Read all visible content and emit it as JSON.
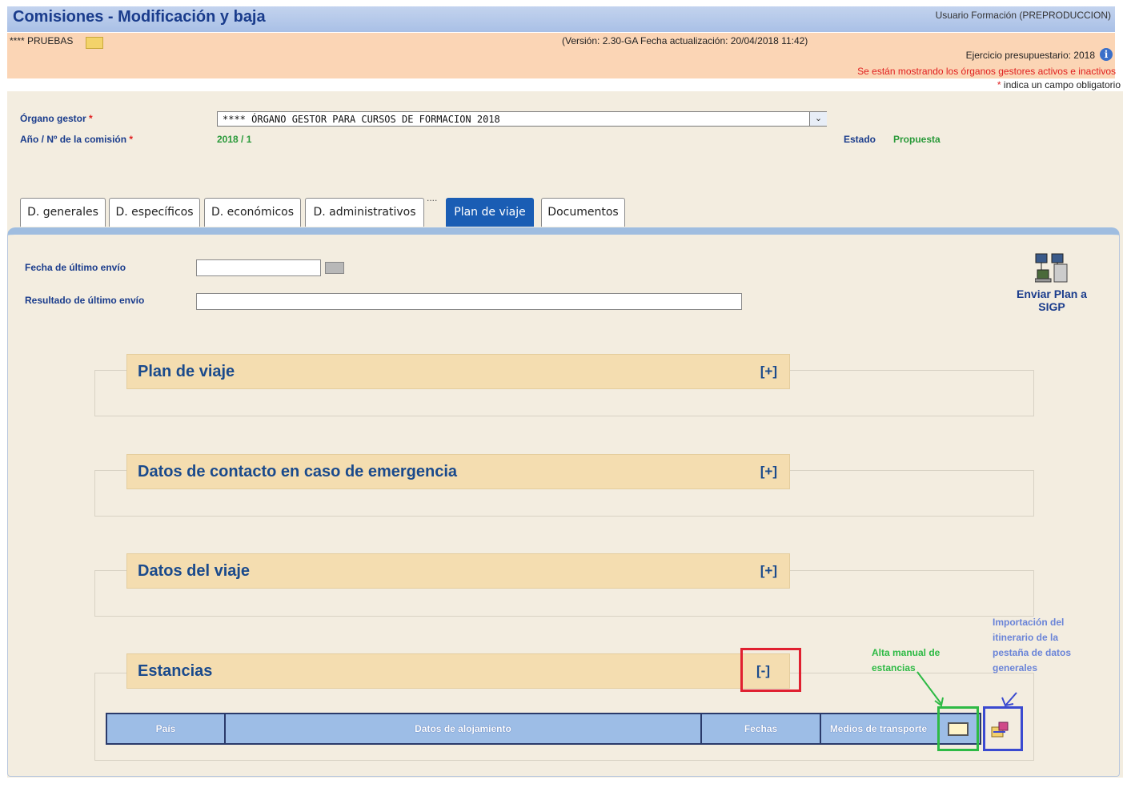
{
  "header": {
    "title": "Comisiones - Modificación y baja",
    "user": "Usuario Formación (PREPRODUCCION)"
  },
  "infobar": {
    "env": "**** PRUEBAS",
    "version": "(Versión: 2.30-GA Fecha actualización: 20/04/2018 11:42)",
    "ejercicio": "Ejercicio presupuestario: 2018",
    "warning": "Se están mostrando los órganos gestores activos e inactivos",
    "required_note_star": "*",
    "required_note": " indica un campo obligatorio"
  },
  "form": {
    "organo_label": "Órgano gestor",
    "organo_value": "**** ÓRGANO GESTOR PARA CURSOS DE FORMACION 2018",
    "anio_label": "Año / Nº de la comisión",
    "anio_value": "2018 / 1",
    "estado_label": "Estado",
    "estado_value": "Propuesta",
    "required_mark": "*"
  },
  "tabs": [
    {
      "label": "D. generales"
    },
    {
      "label": "D. específicos"
    },
    {
      "label": "D. económicos"
    },
    {
      "label": "D. administrativos"
    },
    {
      "label": "Plan de viaje",
      "active": true
    },
    {
      "label": "Documentos"
    }
  ],
  "tabs_dots": "....",
  "plan": {
    "fecha_label": "Fecha de último envío",
    "fecha_value": "",
    "resultado_label": "Resultado de último envío",
    "resultado_value": "",
    "enviar_label": "Enviar Plan a SIGP"
  },
  "sections": [
    {
      "title": "Plan de viaje",
      "toggle": "[+]"
    },
    {
      "title": "Datos de contacto en caso de emergencia",
      "toggle": "[+]"
    },
    {
      "title": "Datos del viaje",
      "toggle": "[+]"
    },
    {
      "title": "Estancias",
      "toggle": "[-]"
    }
  ],
  "estancias_table": {
    "columns": [
      "País",
      "Datos de alojamiento",
      "Fechas",
      "Medios de transporte"
    ]
  },
  "annotations": {
    "alta": "Alta manual de estancias",
    "import": "Importación del itinerario de la pestaña de datos generales"
  },
  "colors": {
    "title_blue": "#1a3c8c",
    "active_tab": "#1a5db4",
    "value_green": "#2a9a3a",
    "warning_red": "#e02020",
    "section_header": "#f4ddb0",
    "highlight_red": "#e02030",
    "highlight_green": "#2eba45",
    "highlight_blue": "#3a4ad0"
  }
}
